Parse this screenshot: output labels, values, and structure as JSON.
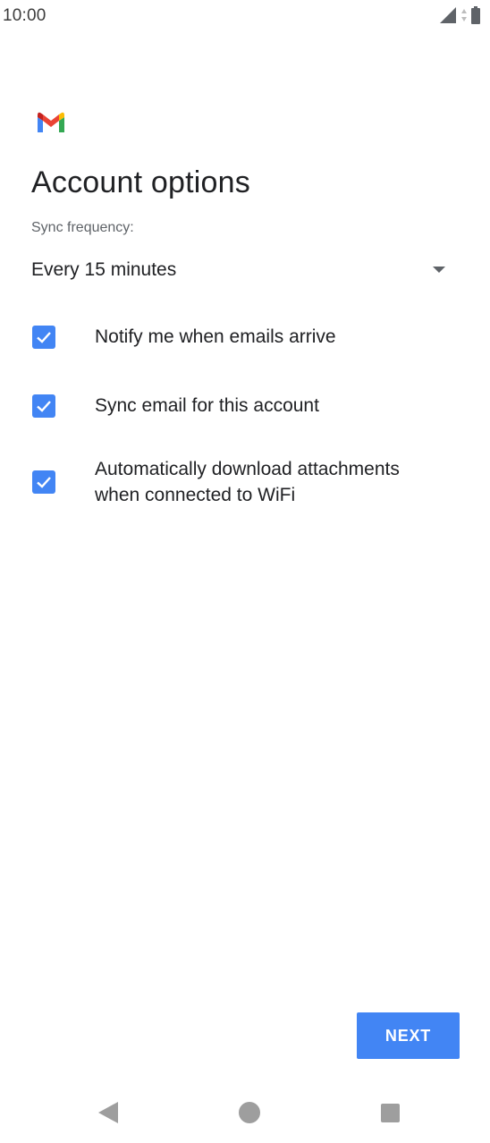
{
  "status_bar": {
    "time": "10:00",
    "icons": [
      "signal-icon",
      "battery-icon"
    ]
  },
  "logo": {
    "name": "gmail-logo-icon"
  },
  "page": {
    "title": "Account options"
  },
  "sync": {
    "label": "Sync frequency:",
    "selected": "Every 15 minutes"
  },
  "options": [
    {
      "label": "Notify me when emails arrive",
      "checked": true
    },
    {
      "label": "Sync email for this account",
      "checked": true
    },
    {
      "label": "Automatically download attachments",
      "label_line2": "when connected to WiFi",
      "checked": true
    }
  ],
  "actions": {
    "next_label": "NEXT"
  },
  "colors": {
    "accent": "#4285f4",
    "text_primary": "#202124",
    "text_secondary": "#5f6368",
    "nav_icons": "#9e9e9e"
  },
  "nav": {
    "icons": [
      "back-icon",
      "home-icon",
      "recents-icon"
    ]
  }
}
